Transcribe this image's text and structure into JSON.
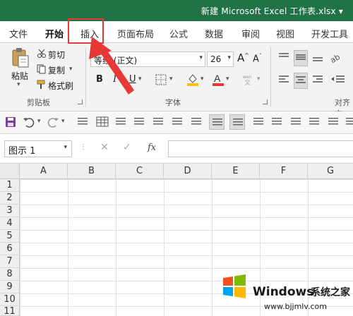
{
  "window": {
    "title": "新建 Microsoft Excel 工作表.xlsx",
    "title_dropdown": "▾"
  },
  "tabs": [
    {
      "label": "文件"
    },
    {
      "label": "开始"
    },
    {
      "label": "插入"
    },
    {
      "label": "页面布局"
    },
    {
      "label": "公式"
    },
    {
      "label": "数据"
    },
    {
      "label": "审阅"
    },
    {
      "label": "视图"
    },
    {
      "label": "开发工具"
    }
  ],
  "ribbon": {
    "clipboard": {
      "paste": "粘贴",
      "cut": "剪切",
      "copy": "复制",
      "format_painter": "格式刷",
      "label": "剪贴板"
    },
    "font": {
      "name": "等线 (正文)",
      "size": "26",
      "bold": "B",
      "italic": "I",
      "underline": "U",
      "label": "字体",
      "grow": "A",
      "shrink": "A"
    },
    "alignment": {
      "label": "对齐方"
    }
  },
  "formula_bar": {
    "name_box": "图示 1",
    "fx": "fx"
  },
  "grid": {
    "columns": [
      "A",
      "B",
      "C",
      "D",
      "E",
      "F",
      "G"
    ],
    "rows": [
      "1",
      "2",
      "3",
      "4",
      "5",
      "6",
      "7",
      "8",
      "9",
      "10",
      "11"
    ]
  },
  "watermark": {
    "brand": "Windows",
    "site_name": "系统之家",
    "url": "www.bjjmlv.com"
  },
  "colors": {
    "accent": "#217346",
    "annotation": "#e53935",
    "font_color": "#e53935",
    "fill_color": "#f4c20d"
  }
}
